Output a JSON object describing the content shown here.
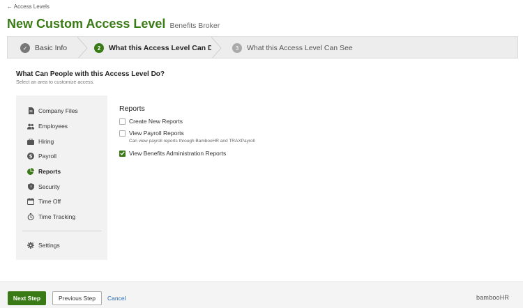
{
  "breadcrumb": {
    "back_label": "← Access Levels"
  },
  "header": {
    "title": "New Custom Access Level",
    "subtitle": "Benefits Broker"
  },
  "steps": [
    {
      "number": "✓",
      "label": "Basic Info",
      "state": "complete"
    },
    {
      "number": "2",
      "label": "What this Access Level Can Do",
      "state": "current"
    },
    {
      "number": "3",
      "label": "What this Access Level Can See",
      "state": "upcoming"
    }
  ],
  "section": {
    "title": "What Can People with this Access Level Do?",
    "subtitle": "Select an area to customize access."
  },
  "sidebar": {
    "items": [
      {
        "label": "Company Files",
        "icon": "file-icon"
      },
      {
        "label": "Employees",
        "icon": "people-icon"
      },
      {
        "label": "Hiring",
        "icon": "briefcase-icon"
      },
      {
        "label": "Payroll",
        "icon": "dollar-icon"
      },
      {
        "label": "Reports",
        "icon": "pie-chart-icon",
        "active": true
      },
      {
        "label": "Security",
        "icon": "shield-icon"
      },
      {
        "label": "Time Off",
        "icon": "calendar-icon"
      },
      {
        "label": "Time Tracking",
        "icon": "stopwatch-icon"
      }
    ],
    "settings_label": "Settings"
  },
  "reports": {
    "title": "Reports",
    "options": [
      {
        "label": "Create New Reports",
        "checked": false
      },
      {
        "label": "View Payroll Reports",
        "checked": false,
        "description": "Can view payroll reports through BambooHR and TRAXPayroll"
      },
      {
        "label": "View Benefits Administration Reports",
        "checked": true
      }
    ]
  },
  "footer": {
    "next_label": "Next Step",
    "previous_label": "Previous Step",
    "cancel_label": "Cancel",
    "brand": "bambooHR"
  },
  "colors": {
    "accent": "#3a7a16",
    "link": "#2a6db5"
  }
}
